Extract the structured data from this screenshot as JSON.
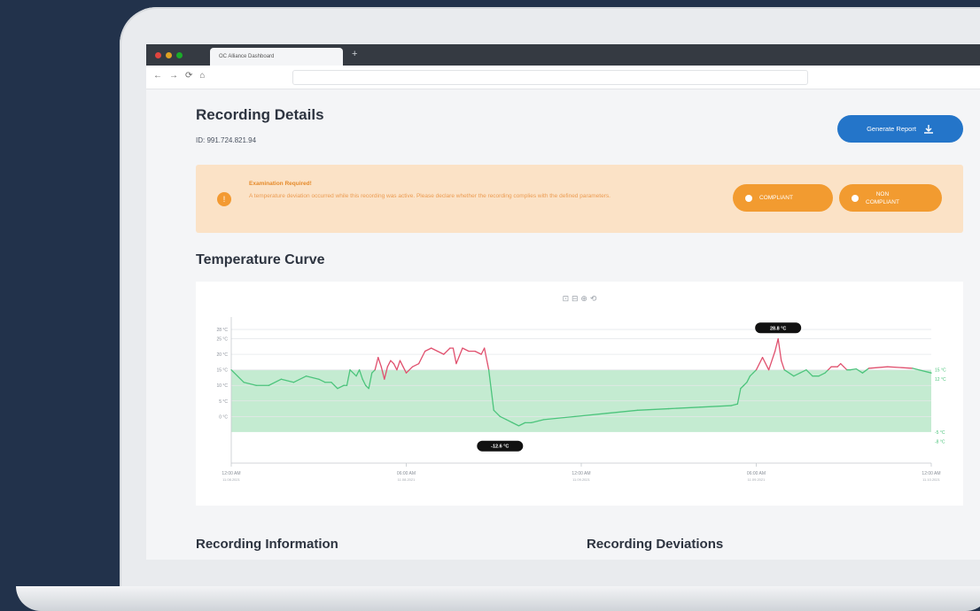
{
  "browser": {
    "tab_title": "OC Alliance Dashboard",
    "new_tab": "+",
    "nav_back": "←",
    "nav_forward": "→",
    "nav_reload": "⟳",
    "nav_home": "⌂",
    "traffic_colors": [
      "#e0443e",
      "#dea123",
      "#1aab29"
    ]
  },
  "header": {
    "title": "Recording Details",
    "id": "ID: 991.724.821.94",
    "report_button": "Generate Report",
    "report_icon": "download-icon"
  },
  "alert": {
    "icon": "!",
    "title": "Examination Required!",
    "text": "A temperature deviation occurred while this recording was active. Please declare whether the recording complies with the defined parameters.",
    "compliant_button": "COMPLIANT",
    "noncompliant_button_line1": "NON",
    "noncompliant_button_line2": "COMPLIANT"
  },
  "chart_section": {
    "title": "Temperature Curve",
    "toolbar_icons": [
      "zoom-icon",
      "zoom-out-icon",
      "pan-icon",
      "reset-icon"
    ],
    "toolbar_glyphs": "⊡ ⊟ ⊕ ⟲"
  },
  "chart_data": {
    "type": "line",
    "ylim": [
      -15,
      32
    ],
    "y_ticks": [
      "28 °C",
      "25 °C",
      "20 °C",
      "15 °C",
      "10 °C",
      "5 °C",
      "0 °C"
    ],
    "y_tick_values": [
      28,
      25,
      20,
      15,
      10,
      5,
      0
    ],
    "right_labels": [
      "15 °C",
      "12 °C",
      "-5 °C",
      "-8 °C"
    ],
    "right_label_values": [
      15,
      12,
      -5,
      -8
    ],
    "x_ticks": [
      {
        "time": "12:00 AM",
        "date": "11.08.2021"
      },
      {
        "time": "06:00 AM",
        "date": "11.08.2021"
      },
      {
        "time": "12:00 AM",
        "date": "11.09.2021"
      },
      {
        "time": "06:00 AM",
        "date": "11.09.2021"
      },
      {
        "time": "12:00 AM",
        "date": "11.10.2021"
      }
    ],
    "band": [
      -5,
      15
    ],
    "min_label": "-12.6 °C",
    "max_label": "28.8 °C",
    "colors": {
      "normal": "#4cc47c",
      "deviation": "#e0506e",
      "band": "#c4ebd1"
    },
    "points": [
      [
        0,
        15
      ],
      [
        0.02,
        11
      ],
      [
        0.04,
        10
      ],
      [
        0.06,
        10
      ],
      [
        0.08,
        12
      ],
      [
        0.1,
        11
      ],
      [
        0.12,
        13
      ],
      [
        0.14,
        12
      ],
      [
        0.15,
        11
      ],
      [
        0.16,
        11
      ],
      [
        0.17,
        9
      ],
      [
        0.18,
        10
      ],
      [
        0.185,
        10
      ],
      [
        0.19,
        15
      ],
      [
        0.2,
        13
      ],
      [
        0.205,
        15
      ],
      [
        0.21,
        12
      ],
      [
        0.215,
        10
      ],
      [
        0.22,
        9
      ],
      [
        0.225,
        14
      ],
      [
        0.23,
        15
      ],
      [
        0.235,
        19
      ],
      [
        0.24,
        16
      ],
      [
        0.245,
        12
      ],
      [
        0.25,
        16
      ],
      [
        0.255,
        18
      ],
      [
        0.26,
        17
      ],
      [
        0.265,
        15
      ],
      [
        0.27,
        18
      ],
      [
        0.275,
        16
      ],
      [
        0.28,
        14
      ],
      [
        0.29,
        16
      ],
      [
        0.3,
        17
      ],
      [
        0.31,
        21
      ],
      [
        0.32,
        22
      ],
      [
        0.33,
        21
      ],
      [
        0.34,
        20
      ],
      [
        0.35,
        22
      ],
      [
        0.355,
        22
      ],
      [
        0.36,
        17
      ],
      [
        0.37,
        22
      ],
      [
        0.38,
        21
      ],
      [
        0.39,
        21
      ],
      [
        0.4,
        20
      ],
      [
        0.405,
        22
      ],
      [
        0.41,
        17
      ],
      [
        0.412,
        15
      ],
      [
        0.42,
        2
      ],
      [
        0.43,
        0
      ],
      [
        0.44,
        -1
      ],
      [
        0.45,
        -2
      ],
      [
        0.46,
        -3
      ],
      [
        0.47,
        -2
      ],
      [
        0.48,
        -2
      ],
      [
        0.5,
        -1
      ],
      [
        0.55,
        0
      ],
      [
        0.6,
        1
      ],
      [
        0.65,
        2
      ],
      [
        0.7,
        2.5
      ],
      [
        0.75,
        3
      ],
      [
        0.8,
        3.5
      ],
      [
        0.81,
        4
      ],
      [
        0.815,
        9
      ],
      [
        0.82,
        10
      ],
      [
        0.825,
        11
      ],
      [
        0.83,
        13
      ],
      [
        0.835,
        14
      ],
      [
        0.84,
        15
      ],
      [
        0.85,
        19
      ],
      [
        0.86,
        15
      ],
      [
        0.87,
        21
      ],
      [
        0.875,
        25
      ],
      [
        0.88,
        18
      ],
      [
        0.885,
        15
      ],
      [
        0.9,
        13
      ],
      [
        0.91,
        14
      ],
      [
        0.92,
        15
      ],
      [
        0.93,
        13
      ],
      [
        0.94,
        13
      ],
      [
        0.95,
        14
      ],
      [
        0.955,
        15
      ],
      [
        0.96,
        16
      ],
      [
        0.97,
        16
      ],
      [
        0.975,
        17
      ],
      [
        0.98,
        16
      ],
      [
        0.985,
        15
      ],
      [
        0.99,
        15
      ],
      [
        1.0,
        15.3
      ],
      [
        1.01,
        14
      ],
      [
        1.02,
        15.5
      ],
      [
        1.05,
        16
      ],
      [
        1.09,
        15.5
      ],
      [
        1.12,
        14
      ]
    ]
  },
  "bottom": {
    "left_title": "Recording Information",
    "right_title": "Recording Deviations"
  }
}
